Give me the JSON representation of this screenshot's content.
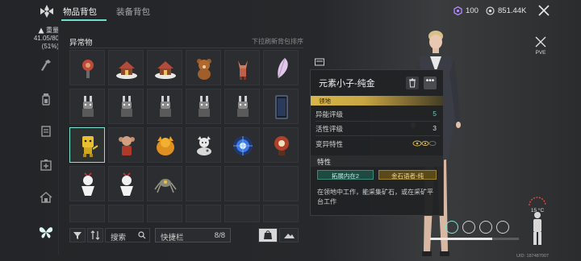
{
  "tabs": {
    "items_bag": "物品背包",
    "equipment_bag": "装备背包"
  },
  "currency": {
    "gems": "100",
    "gold": "851.44K"
  },
  "weight": {
    "label": "重量",
    "value": "41.05/80",
    "percent": "(51%)"
  },
  "inventory": {
    "category": "异常物",
    "hint": "下拉刷新背包排序",
    "items": [
      {
        "icon": "apple-figure-icon"
      },
      {
        "icon": "snow-cabin-icon"
      },
      {
        "icon": "snow-cabin-icon"
      },
      {
        "icon": "teddy-bear-icon"
      },
      {
        "icon": "fox-figure-icon"
      },
      {
        "icon": "feather-icon"
      },
      {
        "icon": "rabbit-bot-icon"
      },
      {
        "icon": "rabbit-bot-icon"
      },
      {
        "icon": "rabbit-bot-icon"
      },
      {
        "icon": "rabbit-bot-icon"
      },
      {
        "icon": "rabbit-bot-icon"
      },
      {
        "icon": "mirror-icon"
      },
      {
        "icon": "yellow-creature-icon"
      },
      {
        "icon": "red-monkey-icon"
      },
      {
        "icon": "golden-beast-icon"
      },
      {
        "icon": "white-cat-icon"
      },
      {
        "icon": "blue-energy-icon"
      },
      {
        "icon": "red-lamp-icon"
      },
      {
        "icon": "white-doll-icon"
      },
      {
        "icon": "white-doll-icon"
      },
      {
        "icon": "spider-bot-icon"
      }
    ]
  },
  "toolbar": {
    "search_label": "搜索",
    "quickbar_label": "快捷栏",
    "quickbar_count": "8/8"
  },
  "detail": {
    "name": "元素小子-纯金",
    "tag": "领地",
    "rows": [
      {
        "key": "异能评级",
        "value": "5",
        "color": "#57d6c6"
      },
      {
        "key": "活性评级",
        "value": "3",
        "color": "#e0e0e0"
      },
      {
        "key": "变异特性",
        "value": "",
        "color": "#d4b64b"
      }
    ],
    "section_title": "特性",
    "traits": [
      "拓展内在2",
      "金石语者-纯"
    ],
    "description": "在领地中工作，能采集矿石，或在采矿平台工作"
  },
  "mode": "PVE",
  "temperature": "15 °C",
  "uid": "UID: 187487007",
  "colors": {
    "accent": "#6fe0d0",
    "gold_tag": "#d8b64a"
  }
}
